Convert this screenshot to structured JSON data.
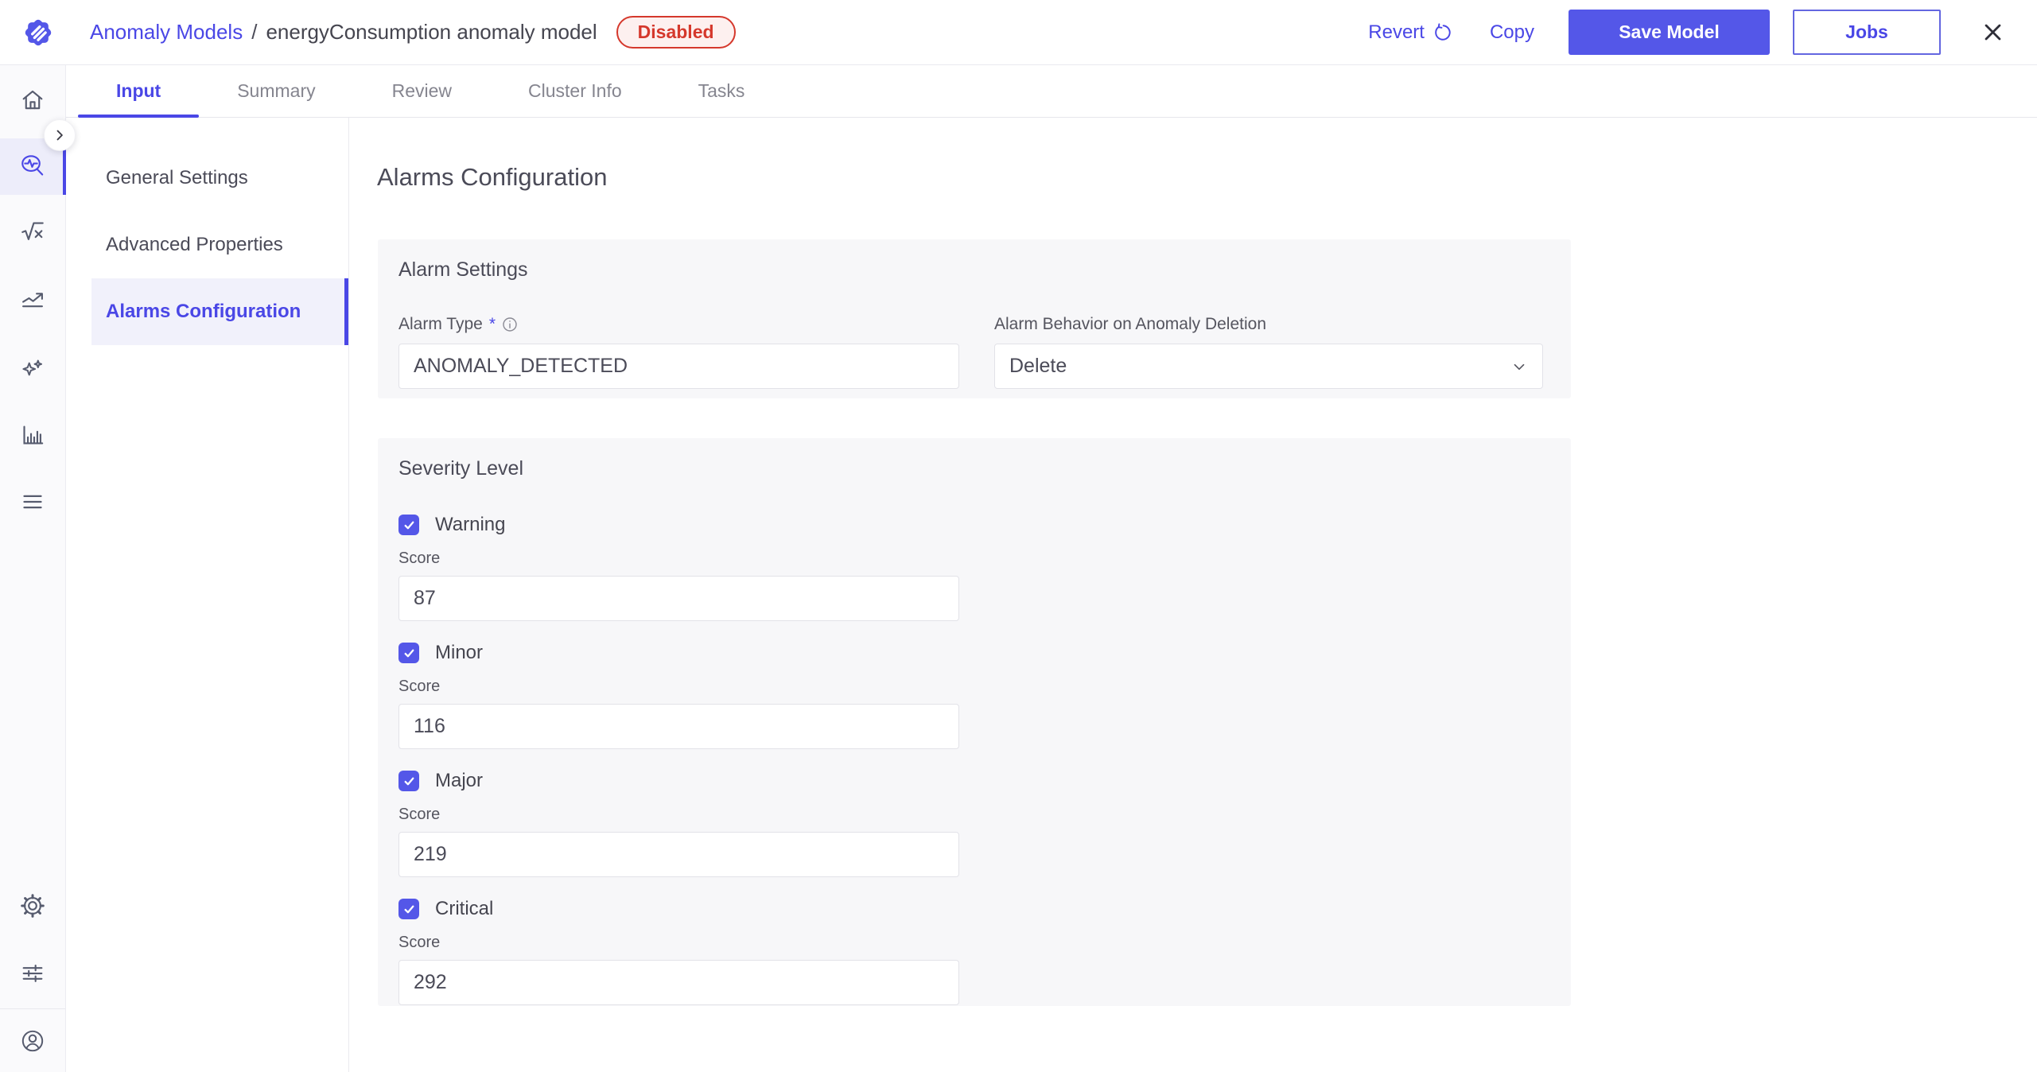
{
  "colors": {
    "primary": "#5457e8",
    "primary_text": "#4a47e6",
    "danger": "#d5382c",
    "danger_bg": "#fdf0ef",
    "card_bg": "#f7f7f9"
  },
  "header": {
    "breadcrumb": {
      "parent": "Anomaly Models",
      "separator": "/",
      "current": "energyConsumption anomaly model"
    },
    "status_badge": "Disabled",
    "actions": {
      "revert": "Revert",
      "copy": "Copy",
      "save": "Save Model",
      "jobs": "Jobs"
    }
  },
  "tabs": [
    {
      "label": "Input",
      "active": true
    },
    {
      "label": "Summary",
      "active": false
    },
    {
      "label": "Review",
      "active": false
    },
    {
      "label": "Cluster Info",
      "active": false
    },
    {
      "label": "Tasks",
      "active": false
    }
  ],
  "icon_rail": {
    "items": [
      "home",
      "anomaly-search",
      "functions",
      "trends",
      "insights",
      "metrics",
      "menu",
      "settings",
      "preferences",
      "profile"
    ],
    "active": "anomaly-search"
  },
  "section_nav": {
    "items": [
      {
        "label": "General Settings",
        "active": false
      },
      {
        "label": "Advanced Properties",
        "active": false
      },
      {
        "label": "Alarms Configuration",
        "active": true
      }
    ]
  },
  "main": {
    "title": "Alarms Configuration",
    "alarm_settings": {
      "title": "Alarm Settings",
      "alarm_type": {
        "label": "Alarm Type",
        "required_marker": "*",
        "value": "ANOMALY_DETECTED"
      },
      "alarm_behavior": {
        "label": "Alarm Behavior on Anomaly Deletion",
        "value": "Delete"
      }
    },
    "severity": {
      "title": "Severity Level",
      "score_label": "Score",
      "levels": [
        {
          "label": "Warning",
          "checked": true,
          "score": "87"
        },
        {
          "label": "Minor",
          "checked": true,
          "score": "116"
        },
        {
          "label": "Major",
          "checked": true,
          "score": "219"
        },
        {
          "label": "Critical",
          "checked": true,
          "score": "292"
        }
      ]
    }
  }
}
